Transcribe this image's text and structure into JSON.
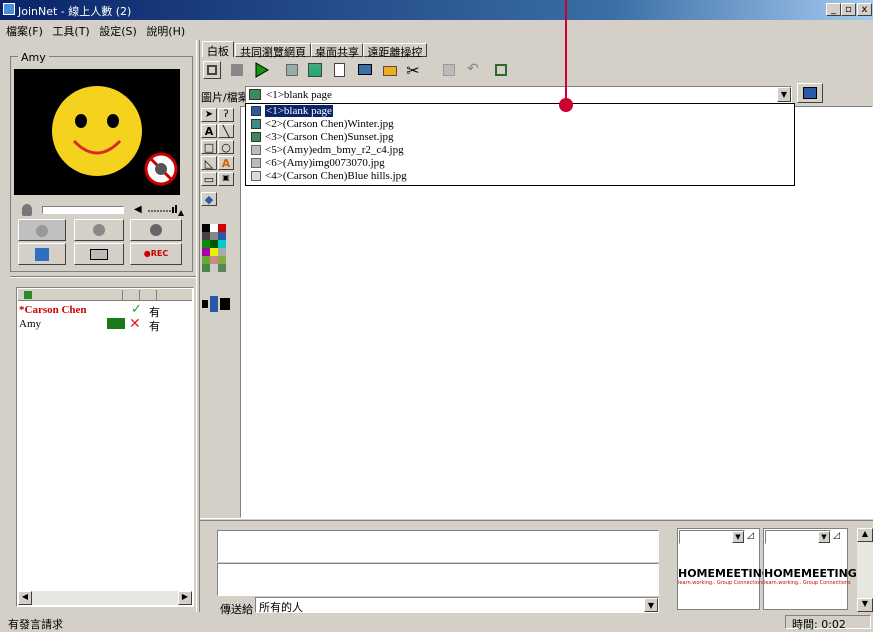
{
  "window": {
    "title": "JoinNet - 線上人數 (2)"
  },
  "menu": [
    "檔案(F)",
    "工具(T)",
    "設定(S)",
    "說明(H)"
  ],
  "video": {
    "name": "Amy"
  },
  "tabs": [
    "白板",
    "共同瀏覽網頁",
    "桌面共享",
    "遠距離操控"
  ],
  "file_selector": {
    "label": "圖片/檔案",
    "value": "<1>blank page"
  },
  "dropdown_items": [
    "<1>blank page",
    "<2>(Carson Chen)Winter.jpg",
    "<3>(Carson Chen)Sunset.jpg",
    "<5>(Amy)edm_bmy_r2_c4.jpg",
    "<6>(Amy)img0073070.jpg",
    "<4>(Carson Chen)Blue hills.jpg"
  ],
  "rec_label": "●REC",
  "participants": [
    {
      "name": "*Carson Chen",
      "status": "有",
      "color": "#cc0000"
    },
    {
      "name": "Amy",
      "status": "有",
      "color": "#000000"
    }
  ],
  "chat": {
    "send_to_label": "傳送給",
    "send_to_value": "所有的人"
  },
  "brand": {
    "logo": "HOMEMEETING",
    "tagline": "learn.working.. Group Connections"
  },
  "status_bar": {
    "left": "有發言請求",
    "right": "時間: 0:02"
  },
  "colors": {
    "title_start": "#0a246a",
    "annotation": "#cc0033"
  }
}
